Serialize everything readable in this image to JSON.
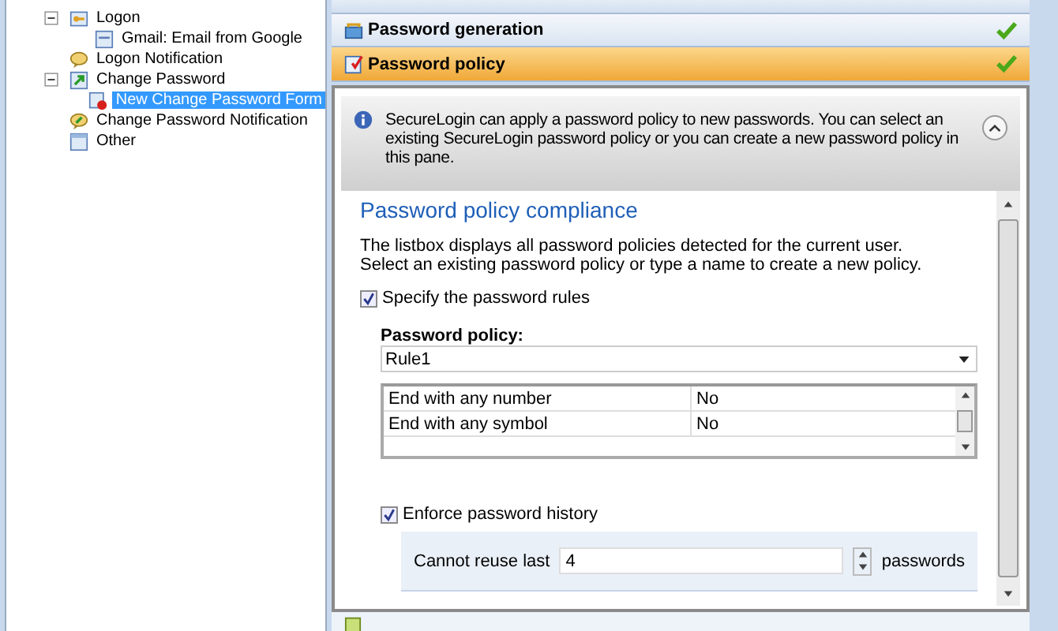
{
  "tree": [
    {
      "label": "Logon",
      "expanded": true,
      "selected": false,
      "children": [
        {
          "label": "Gmail: Email from Google",
          "selected": false
        }
      ]
    },
    {
      "label": "Logon Notification",
      "selected": false
    },
    {
      "label": "Change Password",
      "expanded": true,
      "selected": false,
      "children": [
        {
          "label": "New Change Password Form",
          "selected": true
        }
      ]
    },
    {
      "label": "Change Password Notification",
      "selected": false
    },
    {
      "label": "Other",
      "selected": false
    }
  ],
  "sections": [
    {
      "title": "Password generation",
      "selected": false,
      "complete": true
    },
    {
      "title": "Password policy",
      "selected": true,
      "complete": true
    }
  ],
  "info": "SecureLogin can apply a password policy to new passwords. You can select an existing SecureLogin password policy or you can create a new password policy in this pane.",
  "heading": "Password policy compliance",
  "description": [
    "The listbox displays all password policies detected for the current user.",
    "Select an existing password policy or type a name to create a new policy."
  ],
  "specify_rules": {
    "label": "Specify the password rules",
    "checked": true
  },
  "policy": {
    "label": "Password policy:",
    "value": "Rule1"
  },
  "rules": [
    {
      "name": "End with any number",
      "value": "No"
    },
    {
      "name": "End with any symbol",
      "value": "No"
    }
  ],
  "history": {
    "label": "Enforce password history",
    "checked": true,
    "reuse_label": "Cannot reuse last",
    "reuse_value": "4",
    "unit": "passwords"
  }
}
